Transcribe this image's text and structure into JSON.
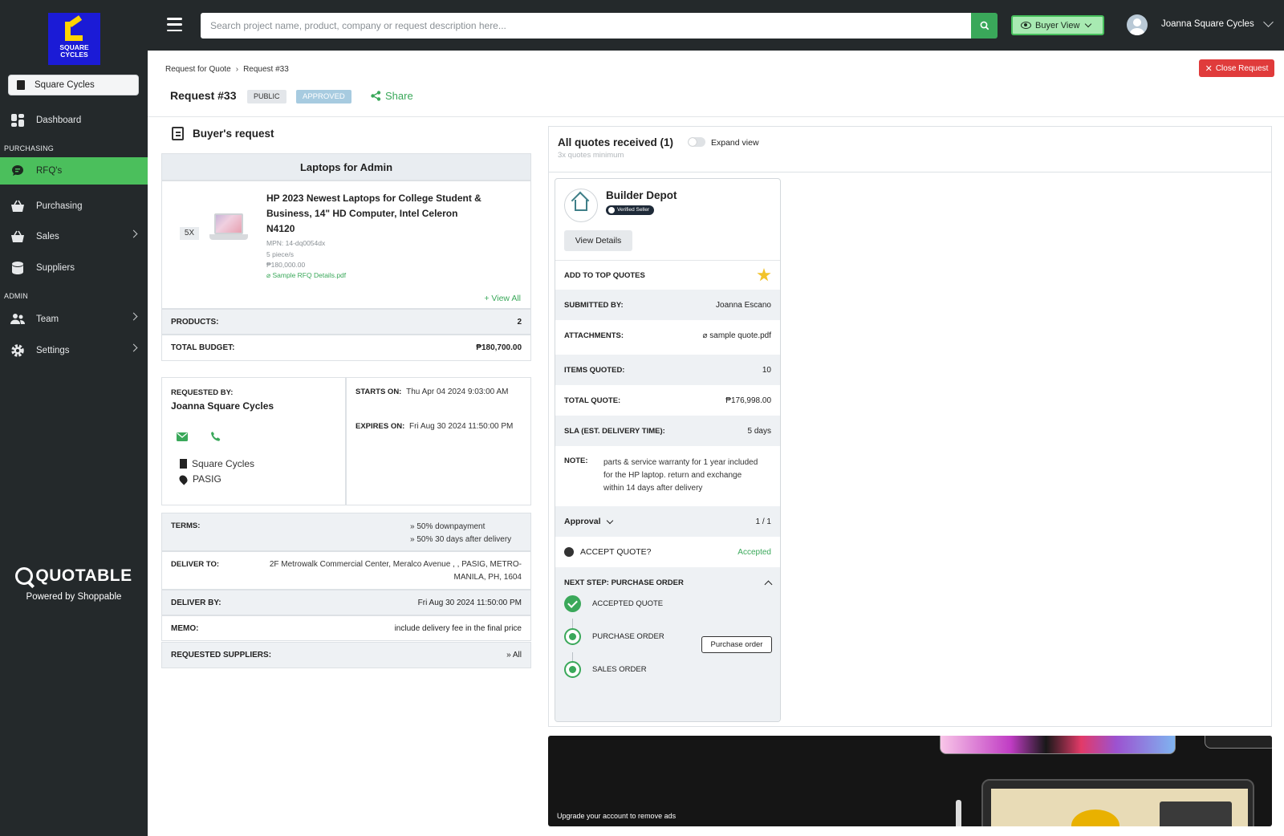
{
  "sidebar": {
    "logo_text": "SQUARE CYCLES",
    "store": "Square Cycles",
    "items": [
      {
        "label": "Dashboard",
        "icon": "dashboard-icon"
      },
      {
        "section": "PURCHASING"
      },
      {
        "label": "RFQ's",
        "icon": "chat-icon",
        "active": true
      },
      {
        "label": "Purchasing",
        "icon": "basket-icon"
      },
      {
        "label": "Sales",
        "icon": "cart-icon"
      },
      {
        "label": "Suppliers",
        "icon": "database-icon"
      },
      {
        "section": "ADMIN"
      },
      {
        "label": "Team",
        "icon": "team-icon"
      },
      {
        "label": "Settings",
        "icon": "gear-icon"
      }
    ],
    "brand": "QUOTABLE",
    "powered": "Powered by Shoppable"
  },
  "topbar": {
    "search_placeholder": "Search project name, product, company or request description here...",
    "buyer_view": "Buyer View",
    "username": "Joanna Square Cycles"
  },
  "header": {
    "crumb1": "Request for Quote",
    "crumb_sep": "›",
    "crumb2": "Request #33",
    "close_label": "Close Request",
    "title": "Request #33",
    "tag_public": "PUBLIC",
    "tag_approved": "APPROVED",
    "share": "Share"
  },
  "buyer": {
    "heading": "Buyer's request",
    "request_name": "Laptops for Admin",
    "product": {
      "qty": "5X",
      "name": "HP 2023 Newest Laptops for College Student & Business, 14\" HD Computer, Intel Celeron N4120",
      "mpn": "MPN: 14-dq0054dx",
      "pieces": "5 piece/s",
      "price": "₱180,000.00",
      "attachment": "Sample RFQ Details.pdf",
      "view_all": "View All"
    },
    "products_label": "PRODUCTS:",
    "products_value": "2",
    "budget_label": "TOTAL BUDGET:",
    "budget_value": "₱180,700.00",
    "requested_by_label": "REQUESTED BY:",
    "requested_by": "Joanna Square Cycles",
    "company": "Square Cycles",
    "location": "PASIG",
    "starts_label": "STARTS ON:",
    "starts_value": "Thu Apr 04 2024 9:03:00 AM",
    "expires_label": "EXPIRES ON:",
    "expires_value": "Fri Aug 30 2024 11:50:00 PM",
    "terms_label": "TERMS:",
    "terms": [
      "» 50% downpayment",
      "» 50% 30 days after delivery"
    ],
    "deliver_to_label": "DELIVER TO:",
    "deliver_to_1": "2F Metrowalk Commercial Center, Meralco Avenue , , PASIG, METRO-",
    "deliver_to_2": "MANILA, PH, 1604",
    "deliver_by_label": "DELIVER BY:",
    "deliver_by": "Fri Aug 30 2024 11:50:00 PM",
    "memo_label": "MEMO:",
    "memo": "include delivery fee in the final price",
    "suppliers_label": "REQUESTED SUPPLIERS:",
    "suppliers": "» All"
  },
  "quotes": {
    "title": "All quotes received (1)",
    "subtitle": "3x quotes minimum",
    "expand": "Expand view",
    "card": {
      "seller": "Builder Depot",
      "verified": "Verified Seller",
      "view_details": "View Details",
      "add_top": "ADD TO TOP QUOTES",
      "submitted_label": "SUBMITTED BY:",
      "submitted": "Joanna Escano",
      "attach_label": "ATTACHMENTS:",
      "attach": "sample quote.pdf",
      "items_label": "ITEMS QUOTED:",
      "items": "10",
      "total_label": "TOTAL QUOTE:",
      "total": "₱176,998.00",
      "sla_label": "SLA (EST. DELIVERY TIME):",
      "sla": "5 days",
      "note_label": "NOTE:",
      "note": "parts & service warranty for 1 year included for the HP laptop. return and exchange within 14 days after delivery",
      "approval_label": "Approval",
      "approval_count": "1 / 1",
      "accept_label": "ACCEPT QUOTE?",
      "accept_status": "Accepted",
      "next_label": "NEXT STEP: PURCHASE ORDER",
      "steps": [
        "ACCEPTED QUOTE",
        "PURCHASE ORDER",
        "SALES ORDER"
      ],
      "po_button": "Purchase order"
    }
  },
  "ad": {
    "text": "Upgrade your account to remove ads"
  },
  "colors": {
    "accent": "#3aa85a",
    "sidebar": "#24292b",
    "danger": "#e03b3b"
  }
}
